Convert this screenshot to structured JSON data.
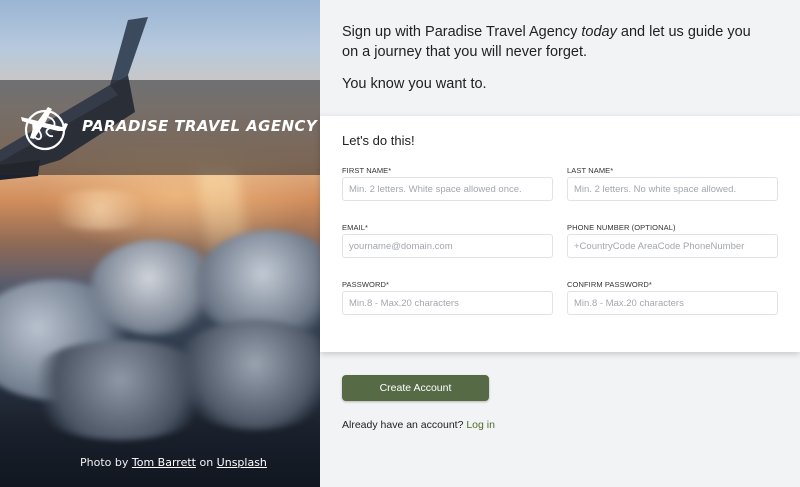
{
  "hero": {
    "brand": "PARADISE TRAVEL AGENCY",
    "credit_prefix": "Photo by",
    "credit_author": "Tom Barrett",
    "credit_mid": "on",
    "credit_site": "Unsplash",
    "logo_icon": "globe-plane-icon"
  },
  "intro": {
    "line1_pre": "Sign up with Paradise Travel Agency",
    "line1_em": "today",
    "line1_post": "and let us guide you on a journey that you will never forget.",
    "line2": "You know you want to."
  },
  "form": {
    "title": "Let's do this!",
    "first_name": {
      "label": "FIRST NAME*",
      "placeholder": "Min. 2 letters. White space allowed once.",
      "value": ""
    },
    "last_name": {
      "label": "LAST NAME*",
      "placeholder": "Min. 2 letters. No white space allowed.",
      "value": ""
    },
    "email": {
      "label": "EMAIL*",
      "placeholder": "yourname@domain.com",
      "value": ""
    },
    "phone": {
      "label": "PHONE NUMBER (OPTIONAL)",
      "placeholder": "+CountryCode AreaCode PhoneNumber",
      "value": ""
    },
    "password": {
      "label": "PASSWORD*",
      "placeholder": "Min.8 - Max.20 characters",
      "value": ""
    },
    "confirm_password": {
      "label": "CONFIRM PASSWORD*",
      "placeholder": "Min.8 - Max.20 characters",
      "value": ""
    }
  },
  "actions": {
    "create_label": "Create Account",
    "login_prompt": "Already have an account?",
    "login_link": "Log in"
  },
  "colors": {
    "accent": "#566b45",
    "link": "#4f6a2f",
    "page_bg": "#f2f3f5"
  }
}
